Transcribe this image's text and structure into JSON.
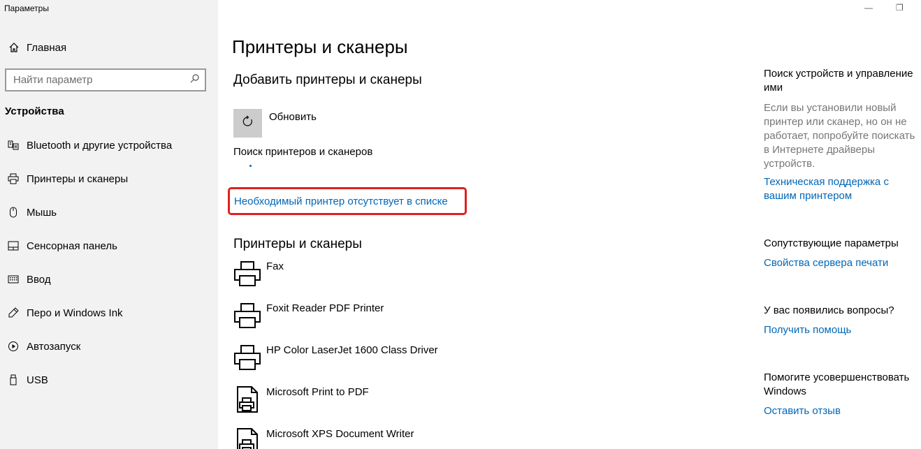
{
  "app": {
    "title": "Параметры"
  },
  "window": {
    "minimize": "—",
    "restore": "❐"
  },
  "sidebar": {
    "home_label": "Главная",
    "search_placeholder": "Найти параметр",
    "group_title": "Устройства",
    "items": [
      {
        "label": "Bluetooth и другие устройства",
        "icon": "bluetooth-devices-icon"
      },
      {
        "label": "Принтеры и сканеры",
        "icon": "printer-icon"
      },
      {
        "label": "Мышь",
        "icon": "mouse-icon"
      },
      {
        "label": "Сенсорная панель",
        "icon": "touchpad-icon"
      },
      {
        "label": "Ввод",
        "icon": "keyboard-icon"
      },
      {
        "label": "Перо и Windows Ink",
        "icon": "pen-icon"
      },
      {
        "label": "Автозапуск",
        "icon": "autoplay-icon"
      },
      {
        "label": "USB",
        "icon": "usb-icon"
      }
    ]
  },
  "main": {
    "page_title": "Принтеры и сканеры",
    "add_section_title": "Добавить принтеры и сканеры",
    "refresh_label": "Обновить",
    "searching_text": "Поиск принтеров и сканеров",
    "missing_printer_link": "Необходимый принтер отсутствует в списке",
    "list_section_title": "Принтеры и сканеры",
    "printers": [
      {
        "name": "Fax",
        "icon": "printer-icon"
      },
      {
        "name": "Foxit Reader PDF Printer",
        "icon": "printer-icon"
      },
      {
        "name": "HP Color LaserJet 1600 Class Driver",
        "icon": "printer-icon"
      },
      {
        "name": "Microsoft Print to PDF",
        "icon": "document-printer-icon"
      },
      {
        "name": "Microsoft XPS Document Writer",
        "icon": "document-printer-icon"
      }
    ]
  },
  "right": {
    "device_search": {
      "title": "Поиск устройств и управление ими",
      "text": "Если вы установили новый принтер или сканер, но он не работает, попробуйте поискать в Интернете драйверы устройств.",
      "link": "Техническая поддержка с вашим принтером"
    },
    "related": {
      "title": "Сопутствующие параметры",
      "link": "Свойства сервера печати"
    },
    "questions": {
      "title": "У вас появились вопросы?",
      "link": "Получить помощь"
    },
    "improve": {
      "title": "Помогите усовершенствовать Windows",
      "link": "Оставить отзыв"
    }
  },
  "colors": {
    "link": "#0067b8",
    "highlight_border": "#e02020",
    "sidebar_bg": "#f2f2f2"
  }
}
